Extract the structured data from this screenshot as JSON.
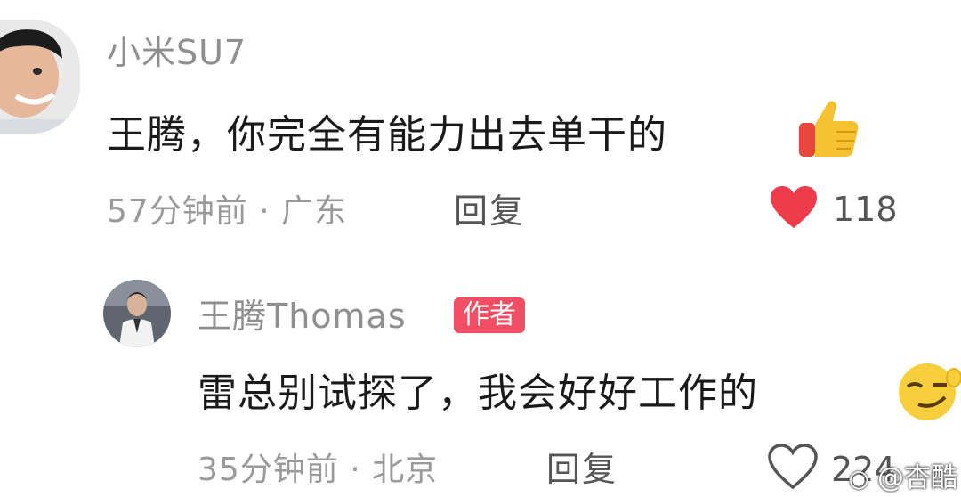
{
  "comments": [
    {
      "username": "小米SU7",
      "text": "王腾，你完全有能力出去单干的",
      "emoji_name": "thumbs-up-emoji",
      "time": "57分钟前",
      "location": "广东",
      "reply_label": "回复",
      "like_count": "118",
      "liked": true
    },
    {
      "username": "王腾Thomas",
      "badge": "作者",
      "text": "雷总别试探了，我会好好工作的",
      "emoji_name": "smirk-emoji",
      "time": "35分钟前",
      "location": "北京",
      "reply_label": "回复",
      "like_count": "224",
      "liked": false
    }
  ],
  "watermark": "@杏酷",
  "colors": {
    "like_red": "#ee3c4a",
    "badge_red": "#ef4e63",
    "muted_gray": "#9a9a9a"
  }
}
